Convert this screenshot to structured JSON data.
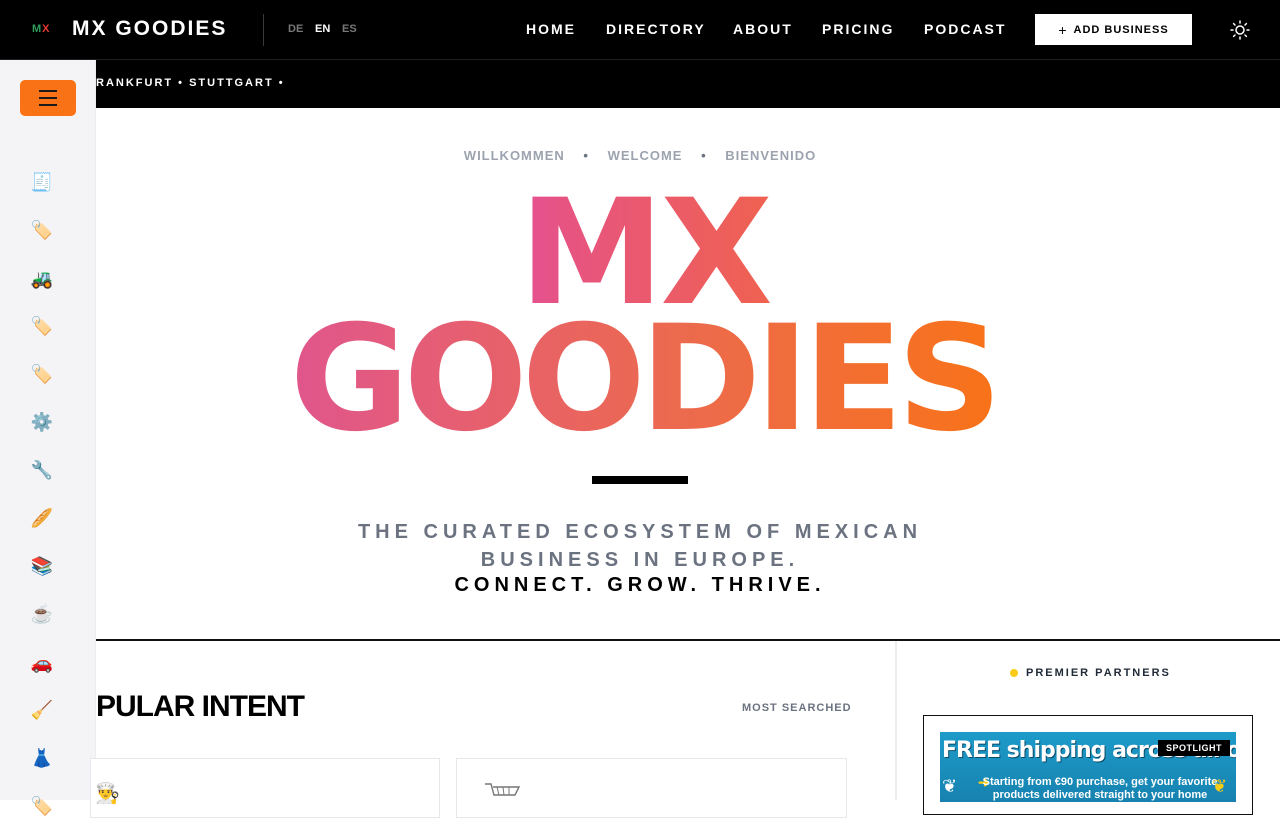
{
  "brand": {
    "mini_m": "M",
    "mini_x": "X",
    "name": "MX GOODIES"
  },
  "languages": [
    {
      "code": "DE",
      "active": false
    },
    {
      "code": "EN",
      "active": true
    },
    {
      "code": "ES",
      "active": false
    }
  ],
  "nav": {
    "items": [
      "HOME",
      "DIRECTORY",
      "ABOUT",
      "PRICING",
      "PODCAST"
    ],
    "add_business_label": "ADD BUSINESS",
    "add_business_icon": "plus-icon",
    "theme_toggle_icon": "sun-icon"
  },
  "marquee": {
    "text": "RANKFURT • STUTTGART •"
  },
  "sidebar": {
    "menu_icon": "hamburger-icon",
    "menu_color": "#f97316",
    "icons": [
      {
        "name": "receipt-icon",
        "glyph": "🧾"
      },
      {
        "name": "tag-icon",
        "glyph": "🏷️"
      },
      {
        "name": "tractor-icon",
        "glyph": "🚜"
      },
      {
        "name": "tag-icon",
        "glyph": "🏷️"
      },
      {
        "name": "tag-icon",
        "glyph": "🏷️"
      },
      {
        "name": "gear-icon",
        "glyph": "⚙️"
      },
      {
        "name": "wrench-icon",
        "glyph": "🔧"
      },
      {
        "name": "bread-icon",
        "glyph": "🥖"
      },
      {
        "name": "books-icon",
        "glyph": "📚"
      },
      {
        "name": "coffee-icon",
        "glyph": "☕"
      },
      {
        "name": "car-icon",
        "glyph": "🚗"
      },
      {
        "name": "broom-icon",
        "glyph": "🧹"
      },
      {
        "name": "dress-icon",
        "glyph": "👗"
      },
      {
        "name": "tag-icon",
        "glyph": "🏷️"
      }
    ]
  },
  "hero": {
    "welcome": [
      "WILLKOMMEN",
      "WELCOME",
      "BIENVENIDO"
    ],
    "title_line1": "MX",
    "title_line2": "GOODIES",
    "tagline_line1": "THE CURATED ECOSYSTEM OF MEXICAN",
    "tagline_line2": "BUSINESS IN EUROPE.",
    "motto": "CONNECT. GROW. THRIVE."
  },
  "popular": {
    "title": "PULAR INTENT",
    "meta": "MOST SEARCHED",
    "cards": [
      {
        "icon": "chef-icon",
        "glyph": "👨‍🍳"
      },
      {
        "icon": "cart-icon",
        "glyph": "🛒"
      }
    ]
  },
  "partners": {
    "heading": "PREMIER PARTNERS",
    "spotlight_label": "SPOTLIGHT",
    "ad": {
      "title": "FREE shipping across all of Europe!",
      "subtitle": "Starting from €90 purchase, get your favorite products delivered straight to your home"
    }
  }
}
